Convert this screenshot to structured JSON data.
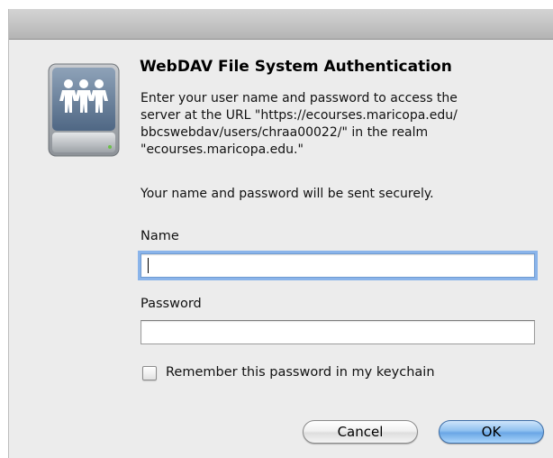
{
  "dialog": {
    "title": "WebDAV File System Authentication",
    "message_lines": [
      "Enter your user name and password to access the",
      "server at the URL \"https://ecourses.maricopa.edu/",
      "bbcswebdav/users/chraa00022/\" in the realm",
      "\"ecourses.maricopa.edu.\""
    ],
    "secure_note": "Your name and password will be sent securely.",
    "icon": "network-drive-people-icon"
  },
  "form": {
    "name_label": "Name",
    "name_value": "",
    "password_label": "Password",
    "password_value": "",
    "remember_label": "Remember this password in my keychain",
    "remember_checked": false
  },
  "buttons": {
    "cancel_label": "Cancel",
    "ok_label": "OK"
  },
  "colors": {
    "window_bg": "#ececec",
    "focus_ring": "#8ab4ea",
    "default_button": "#6aa7e6"
  }
}
